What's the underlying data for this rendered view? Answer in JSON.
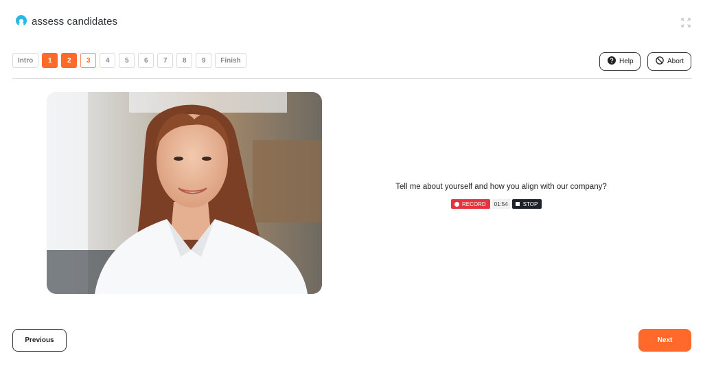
{
  "brand": {
    "name": "assess candidates",
    "accent": "#ff6a2b",
    "logo_color": "#29b6e8"
  },
  "header": {
    "expand_icon": "expand-icon"
  },
  "steps": {
    "items": [
      {
        "label": "Intro",
        "state": "pending"
      },
      {
        "label": "1",
        "state": "done"
      },
      {
        "label": "2",
        "state": "done"
      },
      {
        "label": "3",
        "state": "current"
      },
      {
        "label": "4",
        "state": "pending"
      },
      {
        "label": "5",
        "state": "pending"
      },
      {
        "label": "6",
        "state": "pending"
      },
      {
        "label": "7",
        "state": "pending"
      },
      {
        "label": "8",
        "state": "pending"
      },
      {
        "label": "9",
        "state": "pending"
      },
      {
        "label": "Finish",
        "state": "pending"
      }
    ]
  },
  "actions": {
    "help_label": "Help",
    "abort_label": "Abort"
  },
  "question": {
    "text": "Tell me about yourself and how you align with our company?"
  },
  "recorder": {
    "record_label": "RECORD",
    "timer": "01:54",
    "stop_label": "STOP",
    "record_color": "#e8323f",
    "stop_color": "#1e2329"
  },
  "footer": {
    "previous_label": "Previous",
    "next_label": "Next"
  }
}
